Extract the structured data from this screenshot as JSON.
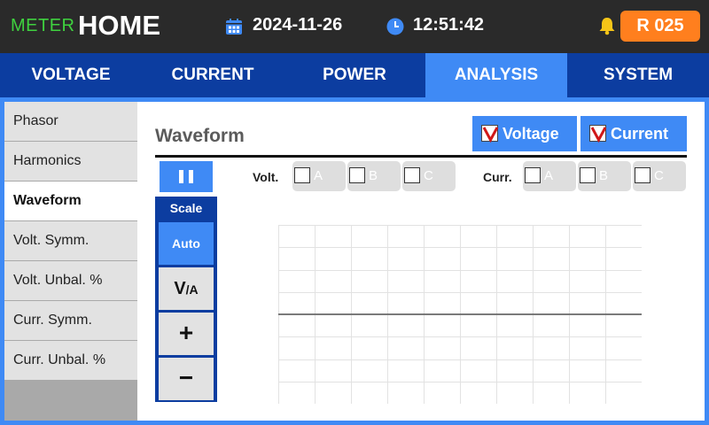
{
  "header": {
    "brand_small": "METER",
    "brand_big": "HOME",
    "date": "2024-11-26",
    "time": "12:51:42",
    "record_label": "R 025",
    "icons": [
      "calendar-icon",
      "clock-icon",
      "bell-icon"
    ]
  },
  "tabs": [
    {
      "label": "VOLTAGE",
      "active": false
    },
    {
      "label": "CURRENT",
      "active": false
    },
    {
      "label": "POWER",
      "active": false
    },
    {
      "label": "ANALYSIS",
      "active": true
    },
    {
      "label": "SYSTEM",
      "active": false
    }
  ],
  "sidebar": {
    "items": [
      {
        "label": "Phasor",
        "active": false
      },
      {
        "label": "Harmonics",
        "active": false
      },
      {
        "label": "Waveform",
        "active": true
      },
      {
        "label": "Volt. Symm.",
        "active": false
      },
      {
        "label": "Volt. Unbal. %",
        "active": false
      },
      {
        "label": "Curr. Symm.",
        "active": false
      },
      {
        "label": "Curr. Unbal. %",
        "active": false
      }
    ]
  },
  "main": {
    "title": "Waveform",
    "legend": [
      {
        "label": "Voltage",
        "checked": true
      },
      {
        "label": "Current",
        "checked": true
      }
    ],
    "volt_label": "Volt.",
    "curr_label": "Curr.",
    "volt_phases": [
      {
        "label": "A",
        "checked": false
      },
      {
        "label": "B",
        "checked": false
      },
      {
        "label": "C",
        "checked": false
      }
    ],
    "curr_phases": [
      {
        "label": "A",
        "checked": false
      },
      {
        "label": "B",
        "checked": false
      },
      {
        "label": "C",
        "checked": false
      }
    ],
    "scale": {
      "title": "Scale",
      "auto_label": "Auto",
      "va_main": "V",
      "va_sub": "/A",
      "plus": "+",
      "minus": "−"
    }
  },
  "colors": {
    "topbar": "#2a2a2a",
    "brand_green": "#3fd13f",
    "accent_blue": "#3f8af5",
    "dark_blue": "#0c3da0",
    "record_orange": "#ff7f1e",
    "check_red": "#d01818",
    "bell_yellow": "#f5c518"
  }
}
